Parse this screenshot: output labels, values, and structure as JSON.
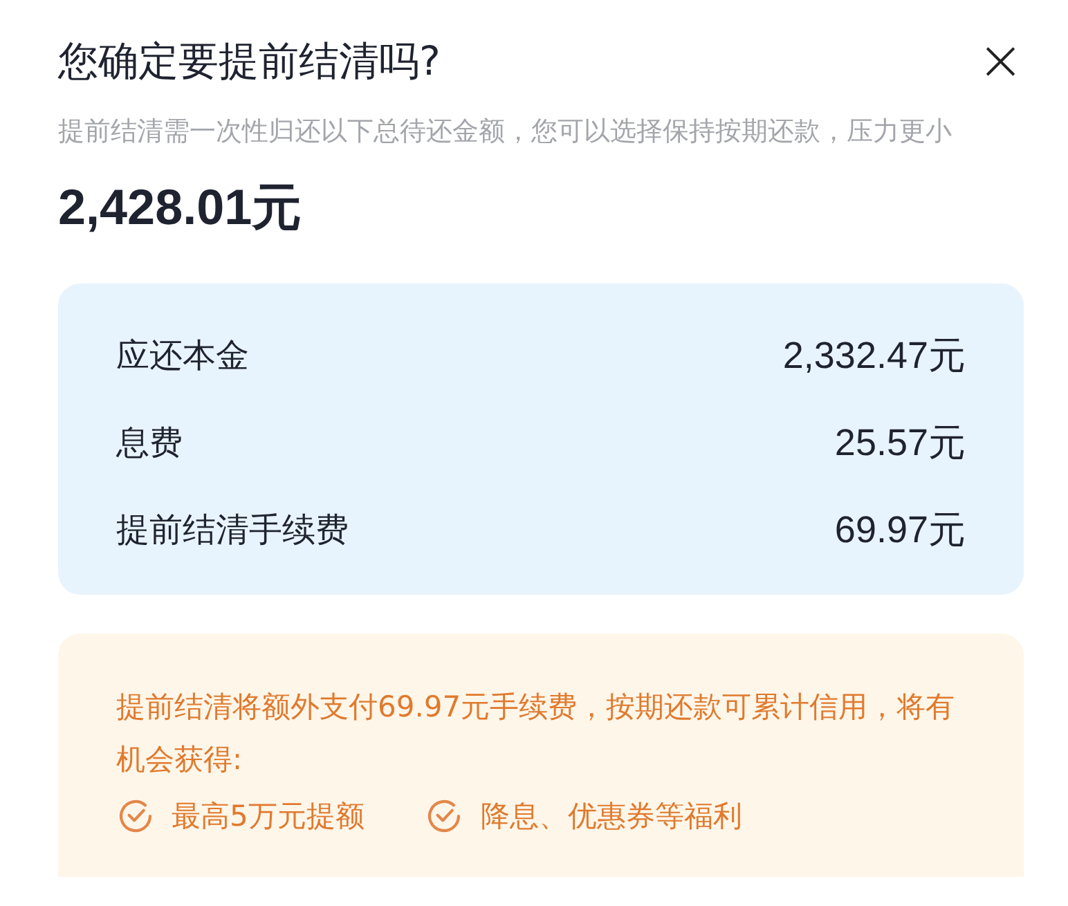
{
  "dialog": {
    "title": "您确定要提前结清吗?",
    "close": "×",
    "description": "提前结清需一次性归还以下总待还金额，您可以选择保持按期还款，压力更小",
    "total": "2,428.01元"
  },
  "breakdown": [
    {
      "label": "应还本金",
      "value": "2,332.47元"
    },
    {
      "label": "息费",
      "value": "25.57元"
    },
    {
      "label": "提前结清手续费",
      "value": "69.97元"
    }
  ],
  "notice": {
    "text": "提前结清将额外支付69.97元手续费，按期还款可累计信用，将有机会获得:",
    "benefits": [
      "最高5万元提额",
      "降息、优惠券等福利"
    ]
  }
}
